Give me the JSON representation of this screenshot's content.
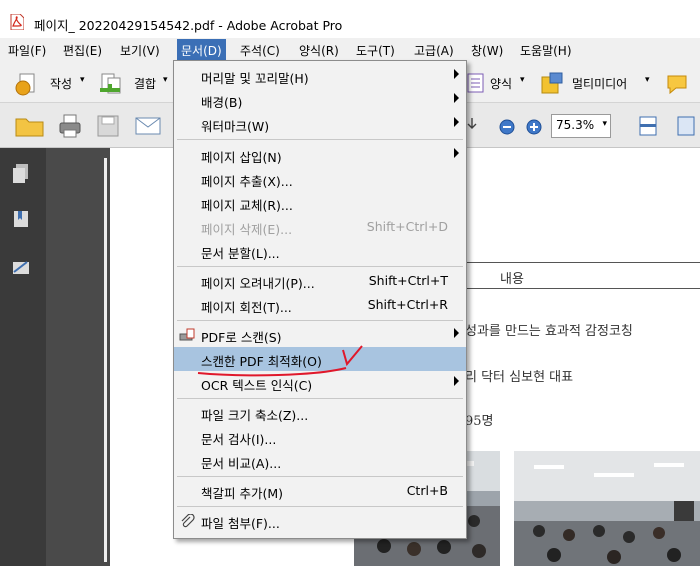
{
  "window": {
    "title": "페이지_ 20220429154542.pdf - Adobe Acrobat Pro"
  },
  "menubar": [
    {
      "label": "파일(F)"
    },
    {
      "label": "편집(E)"
    },
    {
      "label": "보기(V)"
    },
    {
      "label": "문서(D)"
    },
    {
      "label": "주석(C)"
    },
    {
      "label": "양식(R)"
    },
    {
      "label": "도구(T)"
    },
    {
      "label": "고급(A)"
    },
    {
      "label": "창(W)"
    },
    {
      "label": "도움말(H)"
    }
  ],
  "toolbar1": {
    "create": "작성",
    "combine": "결합",
    "forms": "양식",
    "multimedia": "멀티미디어"
  },
  "toolbar2": {
    "zoom": "75.3%"
  },
  "document_menu": {
    "items": [
      {
        "label": "머리말 및 꼬리말(H)",
        "shortcut": "",
        "submenu": true
      },
      {
        "label": "배경(B)",
        "shortcut": "",
        "submenu": true
      },
      {
        "label": "워터마크(W)",
        "shortcut": "",
        "submenu": true
      },
      {
        "label": "페이지 삽입(N)",
        "shortcut": "",
        "submenu": true
      },
      {
        "label": "페이지 추출(X)...",
        "shortcut": ""
      },
      {
        "label": "페이지 교체(R)...",
        "shortcut": ""
      },
      {
        "label": "페이지 삭제(E)...",
        "shortcut": "Shift+Ctrl+D",
        "disabled": true
      },
      {
        "label": "문서 분할(L)...",
        "shortcut": ""
      },
      {
        "label": "페이지 오려내기(P)...",
        "shortcut": "Shift+Ctrl+T"
      },
      {
        "label": "페이지 회전(T)...",
        "shortcut": "Shift+Ctrl+R"
      },
      {
        "label": "PDF로 스캔(S)",
        "shortcut": "",
        "submenu": true
      },
      {
        "label": "스캔한 PDF 최적화(O)",
        "shortcut": "",
        "highlighted": true
      },
      {
        "label": "OCR 텍스트 인식(C)",
        "shortcut": "",
        "submenu": true
      },
      {
        "label": "파일 크기 축소(Z)...",
        "shortcut": ""
      },
      {
        "label": "문서 검사(I)...",
        "shortcut": ""
      },
      {
        "label": "문서 비교(A)...",
        "shortcut": ""
      },
      {
        "label": "책갈피 추가(M)",
        "shortcut": "Ctrl+B"
      },
      {
        "label": "파일 첨부(F)...",
        "shortcut": ""
      }
    ]
  },
  "page": {
    "header_cell": "내용",
    "line1": "성과를 만드는 효과적 감정코칭",
    "line2": "리 닥터 심보현 대표",
    "line3": "95명"
  },
  "annotation_color": "#e0182b",
  "accent": "#3b6fb6"
}
